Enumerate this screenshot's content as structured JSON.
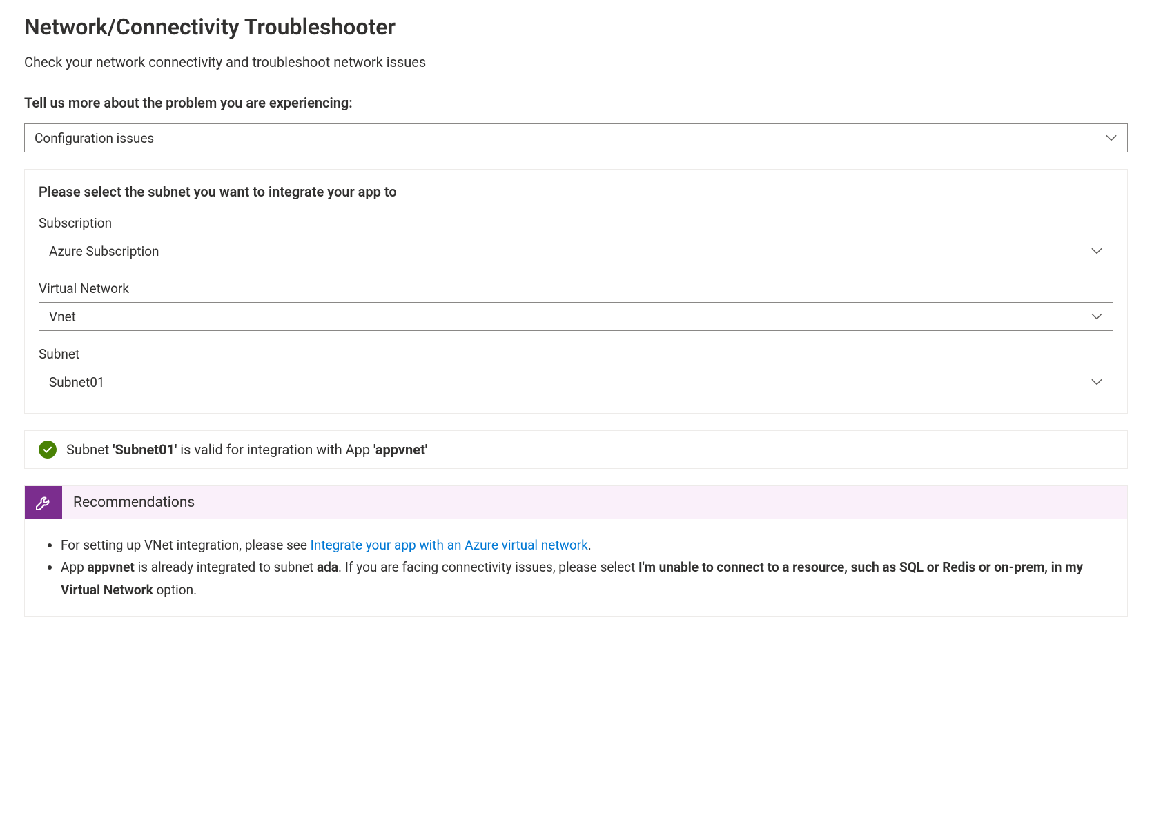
{
  "title": "Network/Connectivity Troubleshooter",
  "subtitle": "Check your network connectivity and troubleshoot network issues",
  "problem_prompt": "Tell us more about the problem you are experiencing:",
  "problem_dropdown": {
    "selected": "Configuration issues"
  },
  "subnet_panel": {
    "heading": "Please select the subnet you want to integrate your app to",
    "subscription": {
      "label": "Subscription",
      "selected": "Azure Subscription"
    },
    "vnet": {
      "label": "Virtual Network",
      "selected": "Vnet"
    },
    "subnet": {
      "label": "Subnet",
      "selected": "Subnet01"
    }
  },
  "status": {
    "prefix": "Subnet ",
    "subnet_name": "'Subnet01'",
    "middle": " is valid for integration with App ",
    "app_name": "'appvnet'"
  },
  "recommendations": {
    "title": "Recommendations",
    "item1": {
      "pre": "For setting up VNet integration, please see ",
      "link": "Integrate your app with an Azure virtual network",
      "post": "."
    },
    "item2": {
      "t1": "App ",
      "b1": "appvnet",
      "t2": " is already integrated to subnet ",
      "b2": "ada",
      "t3": ". If you are facing connectivity issues, please select ",
      "b3": "I'm unable to connect to a resource, such as SQL or Redis or on-prem, in my Virtual Network",
      "t4": " option."
    }
  }
}
